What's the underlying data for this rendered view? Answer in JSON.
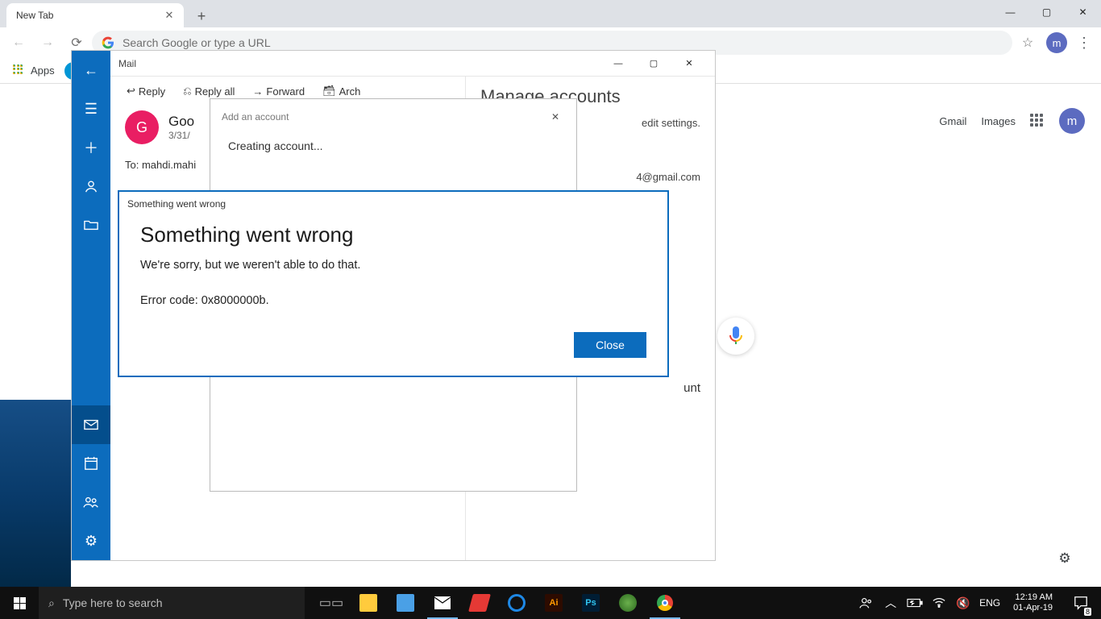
{
  "chrome": {
    "tab_title": "New Tab",
    "omnibox_placeholder": "Search Google or type a URL",
    "apps_label": "Apps",
    "avatar_letter": "m"
  },
  "ntp": {
    "gmail": "Gmail",
    "images": "Images",
    "avatar_letter": "m"
  },
  "mail": {
    "title": "Mail",
    "action_reply": "Reply",
    "action_reply_all": "Reply all",
    "action_forward": "Forward",
    "action_archive": "Arch",
    "sender_initial": "G",
    "sender_name": "Goo",
    "sender_date": "3/31/",
    "to_line": "To: mahdi.mahi"
  },
  "manage": {
    "title": "Manage accounts",
    "hint": "edit settings.",
    "email": "4@gmail.com",
    "add_account_frag": "unt"
  },
  "add_popup": {
    "title": "Add an account",
    "status": "Creating account..."
  },
  "error": {
    "window_title": "Something went wrong",
    "heading": "Something went wrong",
    "message": "We're sorry, but we weren't able to do that.",
    "code_line": "Error code: 0x8000000b.",
    "close_label": "Close"
  },
  "taskbar": {
    "search_placeholder": "Type here to search",
    "lang": "ENG",
    "time": "12:19 AM",
    "date": "01-Apr-19",
    "notif_count": "8"
  }
}
